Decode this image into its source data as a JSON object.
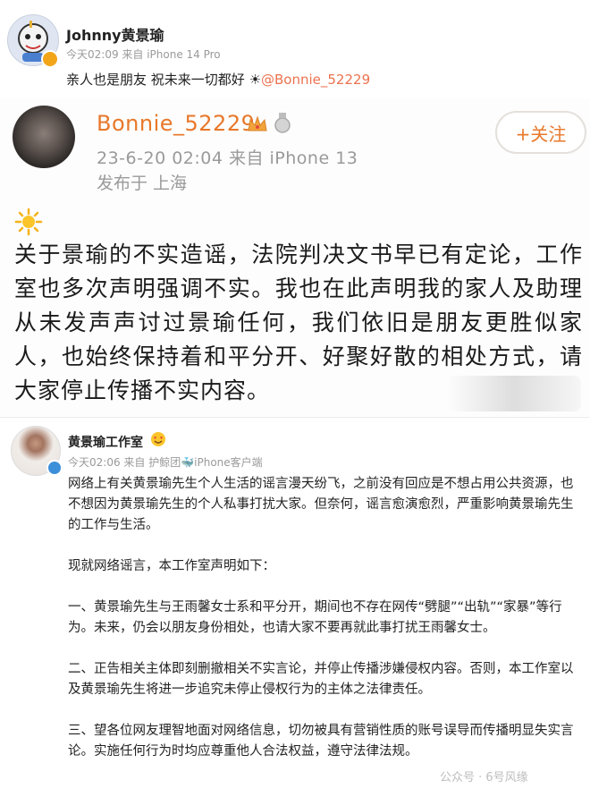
{
  "post1": {
    "username": "Johnny黄景瑜",
    "meta": "今天02:09  来自 iPhone 14 Pro",
    "text": "亲人也是朋友 祝未来一切都好",
    "mention": "@Bonnie_52229"
  },
  "post2": {
    "username": "Bonnie_52229",
    "follow_label": "+关注",
    "meta": "23-6-20 02:04  来自 iPhone 13",
    "location": "发布于 上海",
    "body": "关于景瑜的不实造谣，法院判决文书早已有定论，工作室也多次声明强调不实。我也在此声明我的家人及助理从未发声声讨过景瑜任何，我们依旧是朋友更胜似家人，也始终保持着和平分开、好聚好散的相处方式，请大家停止传播不实内容。"
  },
  "post3": {
    "username": "黄景瑜工作室",
    "meta": "今天02:06  来自 护鲸团🐳iPhone客户端",
    "paragraphs": [
      "网络上有关黄景瑜先生个人生活的谣言漫天纷飞，之前没有回应是不想占用公共资源，也不想因为黄景瑜先生的个人私事打扰大家。但奈何，谣言愈演愈烈，严重影响黄景瑜先生的工作与生活。",
      "现就网络谣言，本工作室声明如下：",
      "一、黄景瑜先生与王雨馨女士系和平分开，期间也不存在网传“劈腿”“出轨”“家暴”等行为。未来，仍会以朋友身份相处，也请大家不要再就此事打扰王雨馨女士。",
      "二、正告相关主体即刻删撤相关不实言论，并停止传播涉嫌侵权内容。否则，本工作室以及黄景瑜先生将进一步追究未停止侵权行为的主体之法律责任。",
      "三、望各位网友理智地面对网络信息，切勿被具有营销性质的账号误导而传播明显失实言论。实施任何行为时均应尊重他人合法权益，遵守法律法规。"
    ]
  },
  "watermark": "公众号 · 6号风缘",
  "colors": {
    "accent": "#e8782a",
    "mention": "#eb7350",
    "meta_gray": "#9a9a9a"
  }
}
